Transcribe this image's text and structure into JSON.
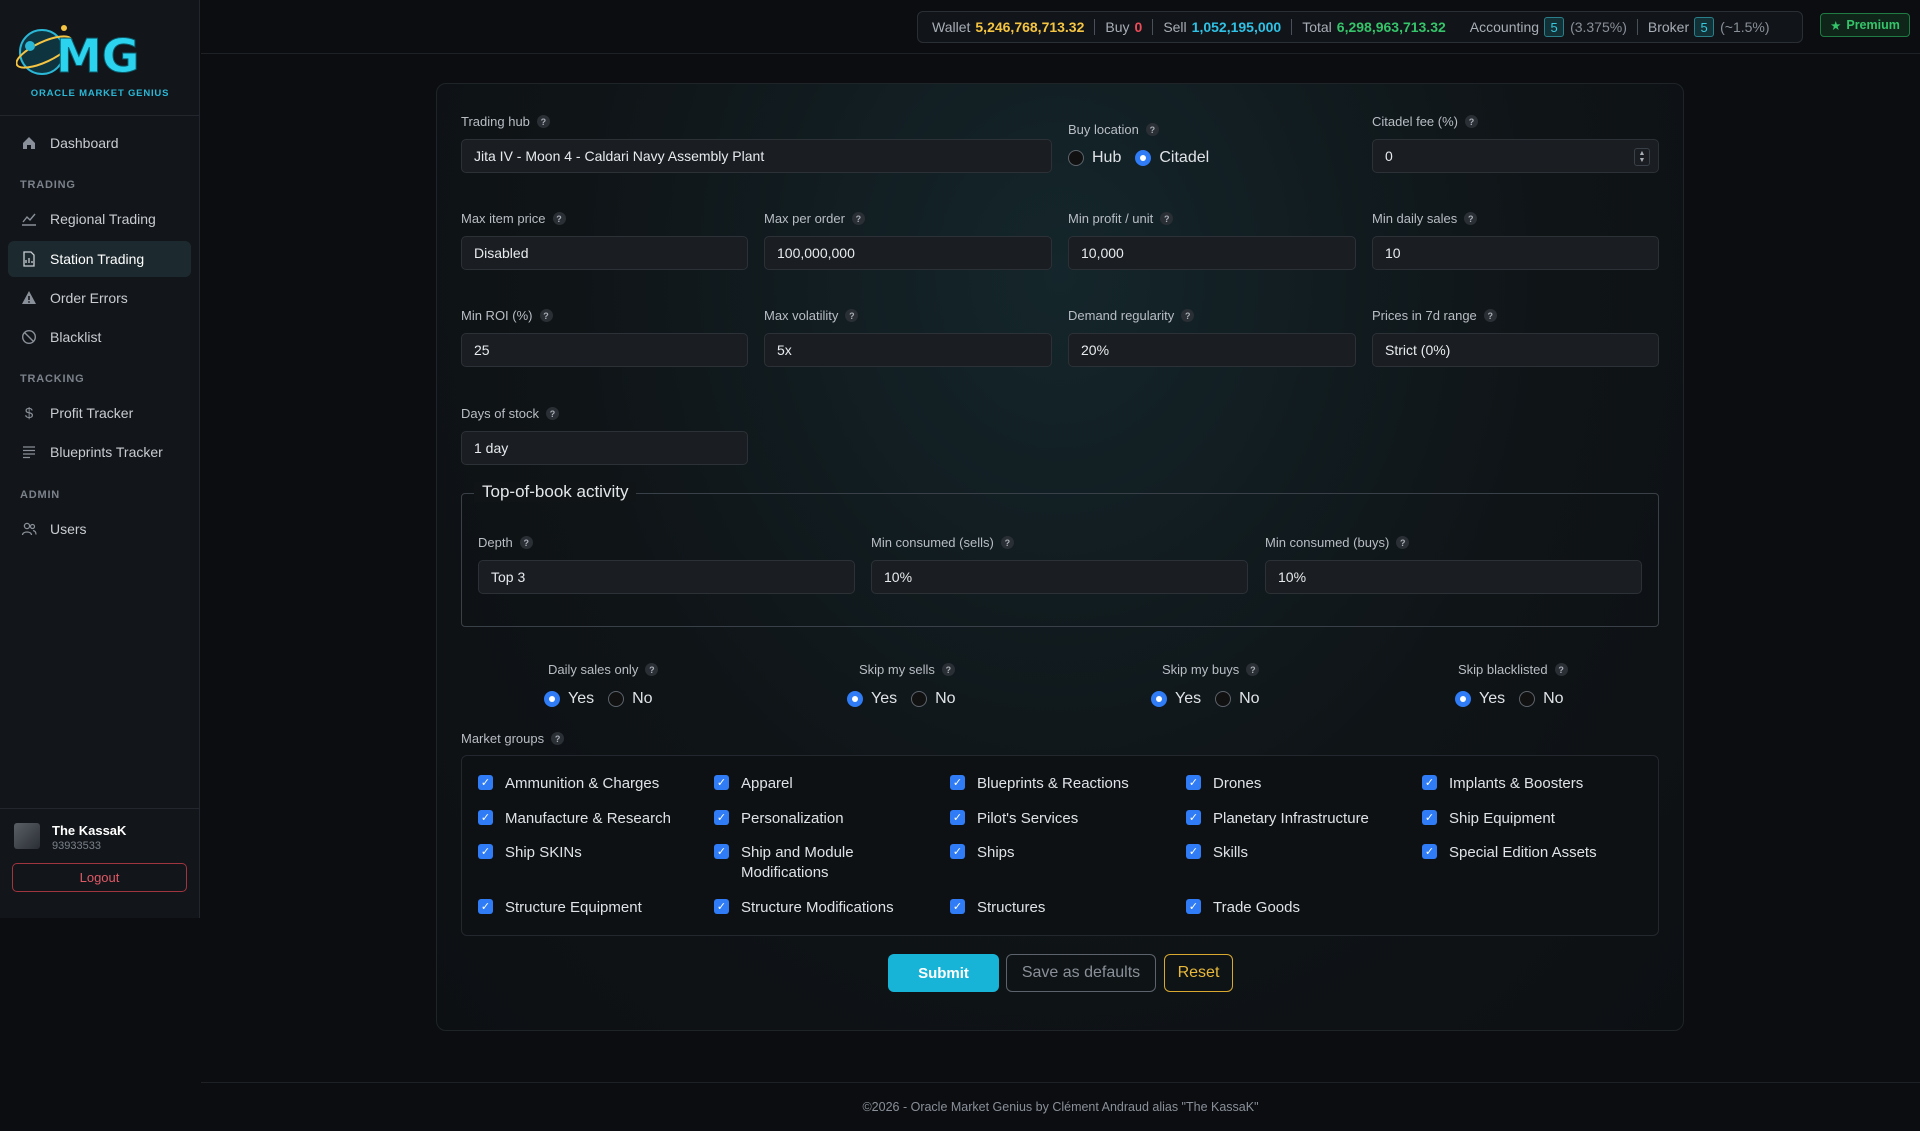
{
  "brand": {
    "logo_letters": "MG",
    "subtitle": "ORACLE MARKET GENIUS"
  },
  "nav": {
    "dashboard": "Dashboard",
    "section_trading": "TRADING",
    "regional_trading": "Regional Trading",
    "station_trading": "Station Trading",
    "order_errors": "Order Errors",
    "blacklist": "Blacklist",
    "section_tracking": "TRACKING",
    "profit_tracker": "Profit Tracker",
    "blueprints_tracker": "Blueprints Tracker",
    "section_admin": "ADMIN",
    "users": "Users",
    "active_item": "Station Trading"
  },
  "user": {
    "name": "The KassaK",
    "id": "93933533",
    "logout_label": "Logout"
  },
  "topbar": {
    "wallet_label": "Wallet",
    "wallet_value": "5,246,768,713.32",
    "buy_label": "Buy",
    "buy_value": "0",
    "sell_label": "Sell",
    "sell_value": "1,052,195,000",
    "total_label": "Total",
    "total_value": "6,298,963,713.32",
    "accounting_label": "Accounting",
    "accounting_level": "5",
    "accounting_pct": "(3.375%)",
    "broker_label": "Broker",
    "broker_level": "5",
    "broker_pct": "(~1.5%)",
    "premium_label": "Premium"
  },
  "form": {
    "trading_hub": {
      "label": "Trading hub",
      "value": "Jita IV - Moon 4 - Caldari Navy Assembly Plant"
    },
    "buy_location": {
      "label": "Buy location",
      "options": [
        "Hub",
        "Citadel"
      ],
      "selected": "Citadel"
    },
    "citadel_fee": {
      "label": "Citadel fee (%)",
      "value": "0"
    },
    "max_item_price": {
      "label": "Max item price",
      "value": "Disabled"
    },
    "max_per_order": {
      "label": "Max per order",
      "value": "100,000,000"
    },
    "min_profit_unit": {
      "label": "Min profit / unit",
      "value": "10,000"
    },
    "min_daily_sales": {
      "label": "Min daily sales",
      "value": "10"
    },
    "min_roi": {
      "label": "Min ROI (%)",
      "value": "25"
    },
    "max_volatility": {
      "label": "Max volatility",
      "value": "5x"
    },
    "demand_regularity": {
      "label": "Demand regularity",
      "value": "20%"
    },
    "prices_7d_range": {
      "label": "Prices in 7d range",
      "value": "Strict (0%)"
    },
    "days_of_stock": {
      "label": "Days of stock",
      "value": "1 day"
    },
    "top_of_book": {
      "legend": "Top-of-book activity",
      "depth": {
        "label": "Depth",
        "value": "Top 3"
      },
      "min_consumed_sells": {
        "label": "Min consumed (sells)",
        "value": "10%"
      },
      "min_consumed_buys": {
        "label": "Min consumed (buys)",
        "value": "10%"
      }
    },
    "daily_sales_only": {
      "label": "Daily sales only",
      "yes": "Yes",
      "no": "No",
      "selected": "Yes"
    },
    "skip_my_sells": {
      "label": "Skip my sells",
      "yes": "Yes",
      "no": "No",
      "selected": "Yes"
    },
    "skip_my_buys": {
      "label": "Skip my buys",
      "yes": "Yes",
      "no": "No",
      "selected": "Yes"
    },
    "skip_blacklisted": {
      "label": "Skip blacklisted",
      "yes": "Yes",
      "no": "No",
      "selected": "Yes"
    },
    "market_groups_label": "Market groups",
    "market_groups": [
      "Ammunition & Charges",
      "Apparel",
      "Blueprints & Reactions",
      "Drones",
      "Implants & Boosters",
      "Manufacture & Research",
      "Personalization",
      "Pilot's Services",
      "Planetary Infrastructure",
      "Ship Equipment",
      "Ship SKINs",
      "Ship and Module Modifications",
      "Ships",
      "Skills",
      "Special Edition Assets",
      "Structure Equipment",
      "Structure Modifications",
      "Structures",
      "Trade Goods"
    ],
    "help_mark": "?",
    "submit_label": "Submit",
    "save_defaults_label": "Save as defaults",
    "reset_label": "Reset"
  },
  "footer": {
    "text": "©2026 - Oracle Market Genius by Clément Andraud alias \"The KassaK\""
  },
  "colors": {
    "accent": "#18b4d8",
    "checkbox": "#2f7cf6",
    "wallet": "#f5c542",
    "buy": "#ef4c5a",
    "sell": "#2fc2e6",
    "total": "#35c46a",
    "reset": "#d9a92f"
  }
}
